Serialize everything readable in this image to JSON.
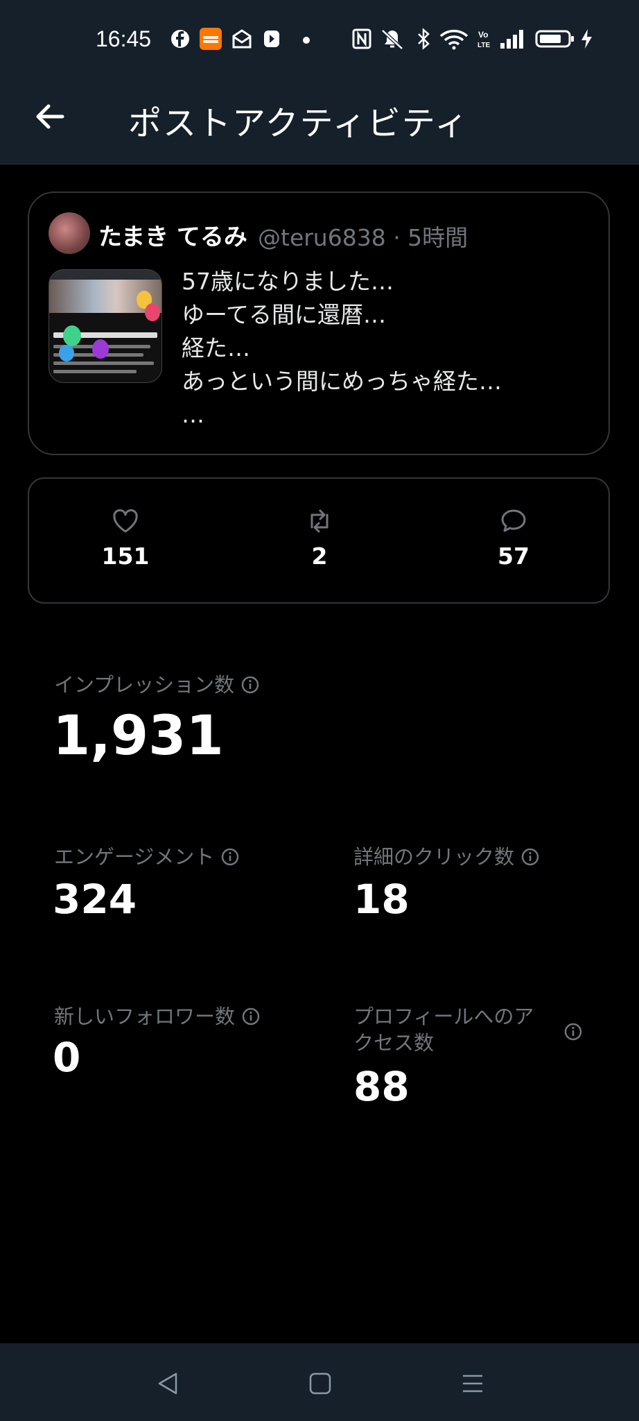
{
  "status_bar": {
    "time": "16:45",
    "icons": [
      "facebook-icon",
      "temu-icon",
      "mail-icon",
      "video-icon",
      "dot-icon",
      "nfc-icon",
      "mute-icon",
      "bluetooth-icon",
      "wifi-icon",
      "volte-icon",
      "signal-icon",
      "battery-icon",
      "charging-icon"
    ]
  },
  "header": {
    "title": "ポストアクティビティ"
  },
  "post": {
    "author": "たまき てるみ",
    "handle_time": "@teru6838 · 5時間",
    "lines": [
      "57歳になりました…",
      "ゆーてる間に還暦…",
      "経た…",
      "あっという間にめっちゃ経た…",
      "…"
    ]
  },
  "engagement": {
    "likes": "151",
    "reposts": "2",
    "replies": "57"
  },
  "metrics": {
    "impressions": {
      "label": "インプレッション数",
      "value": "1,931"
    },
    "engagements": {
      "label": "エンゲージメント",
      "value": "324"
    },
    "detail_clicks": {
      "label": "詳細のクリック数",
      "value": "18"
    },
    "new_followers": {
      "label": "新しいフォロワー数",
      "value": "0"
    },
    "profile_visits": {
      "label_line1": "プロフィールへのア",
      "label_line2": "クセス数",
      "value": "88"
    }
  },
  "colors": {
    "background": "#000000",
    "bar": "#15202b",
    "muted": "#71767b",
    "border": "#333639"
  }
}
